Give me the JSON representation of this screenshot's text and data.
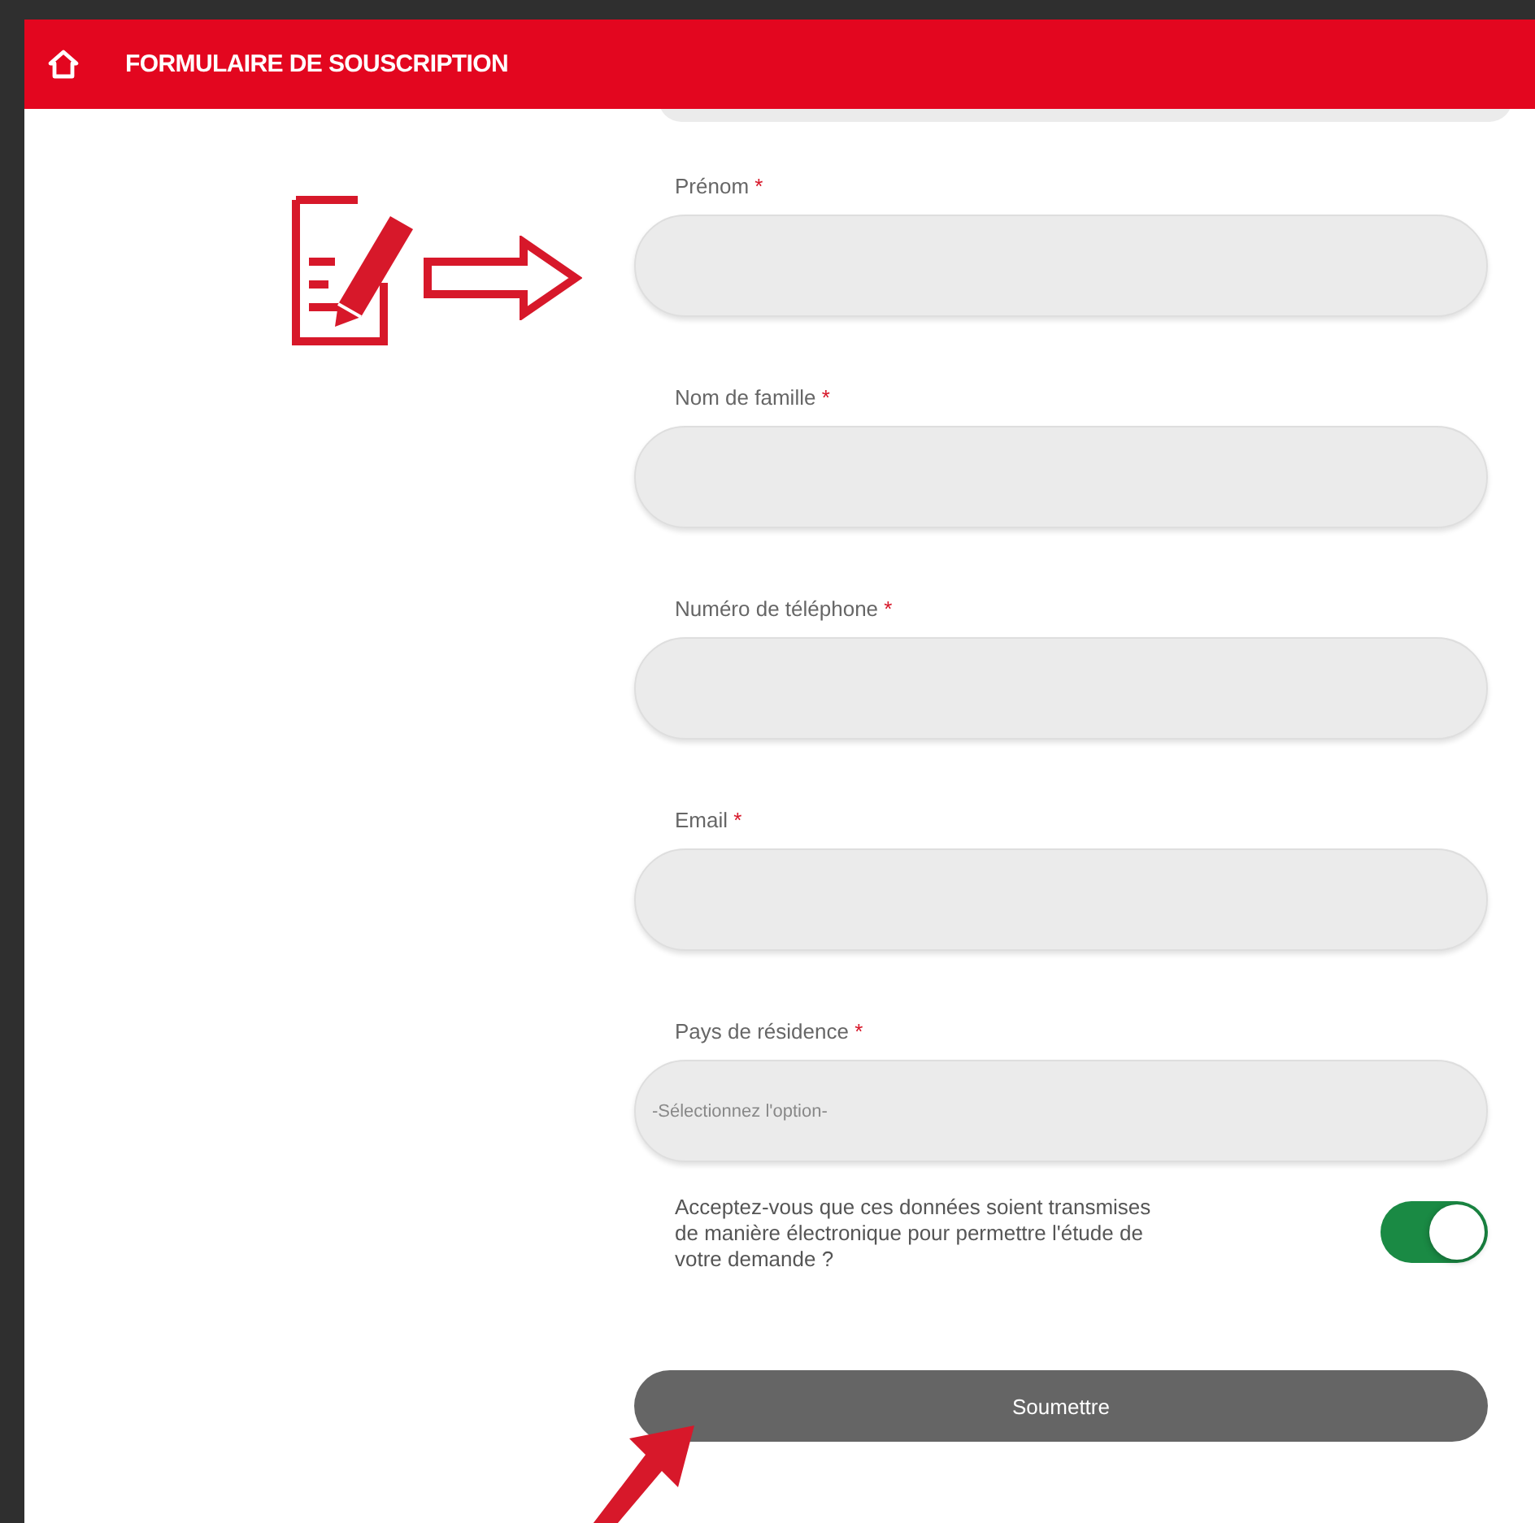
{
  "header": {
    "title": "FORMULAIRE DE SOUSCRIPTION"
  },
  "fields": [
    {
      "label": "Prénom",
      "required_mark": "*",
      "kind": "text"
    },
    {
      "label": "Nom de famille",
      "required_mark": "*",
      "kind": "text"
    },
    {
      "label": "Numéro de téléphone",
      "required_mark": "*",
      "kind": "text"
    },
    {
      "label": "Email",
      "required_mark": "*",
      "kind": "text"
    },
    {
      "label": "Pays de résidence",
      "required_mark": "*",
      "kind": "select",
      "placeholder": "-Sélectionnez l'option-"
    }
  ],
  "consent": {
    "label": "Acceptez-vous que ces données soient transmises de manière électronique pour permettre l'étude de votre demande ?",
    "on": true
  },
  "submit": {
    "label": "Soumettre"
  }
}
